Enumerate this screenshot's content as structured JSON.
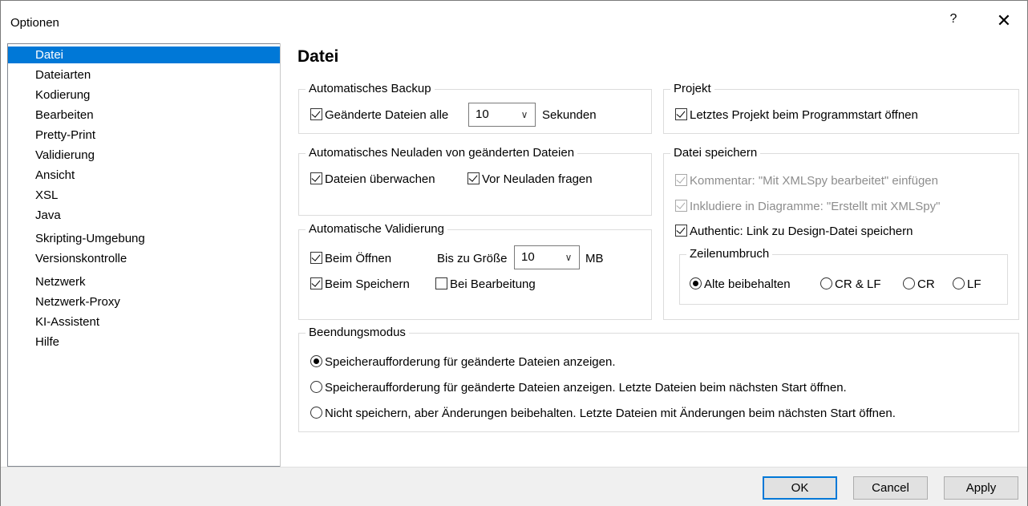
{
  "window": {
    "title": "Optionen",
    "help_label": "?",
    "close_label": "✕"
  },
  "sidebar": {
    "items": [
      {
        "label": "Datei",
        "selected": true
      },
      {
        "label": "Dateiarten"
      },
      {
        "label": "Kodierung"
      },
      {
        "label": "Bearbeiten"
      },
      {
        "label": "Pretty-Print"
      },
      {
        "label": "Validierung"
      },
      {
        "label": "Ansicht"
      },
      {
        "label": "XSL"
      },
      {
        "label": "Java"
      },
      {
        "label": "Skripting-Umgebung"
      },
      {
        "label": "Versionskontrolle"
      },
      {
        "label": "Netzwerk"
      },
      {
        "label": "Netzwerk-Proxy"
      },
      {
        "label": "KI-Assistent"
      },
      {
        "label": "Hilfe"
      }
    ]
  },
  "page": {
    "title": "Datei"
  },
  "backup": {
    "group_label": "Automatisches Backup",
    "checkbox_label": "Geänderte Dateien alle",
    "interval_value": "10",
    "unit_label": "Sekunden"
  },
  "reload": {
    "group_label": "Automatisches Neuladen von geänderten Dateien",
    "watch_label": "Dateien überwachen",
    "ask_label": "Vor Neuladen fragen"
  },
  "validation": {
    "group_label": "Automatische Validierung",
    "open_label": "Beim Öffnen",
    "size_label": "Bis zu Größe",
    "size_value": "10",
    "size_unit": "MB",
    "save_label": "Beim Speichern",
    "edit_label": "Bei Bearbeitung"
  },
  "project": {
    "group_label": "Projekt",
    "open_last_label": "Letztes Projekt beim Programmstart öffnen"
  },
  "save": {
    "group_label": "Datei speichern",
    "comment_label": "Kommentar: \"Mit XMLSpy bearbeitet\" einfügen",
    "include_label": "Inkludiere in Diagramme: \"Erstellt mit XMLSpy\"",
    "authentic_label": "Authentic: Link zu Design-Datei speichern",
    "linebreak": {
      "group_label": "Zeilenumbruch",
      "keep_label": "Alte beibehalten",
      "crlf_label": "CR & LF",
      "cr_label": "CR",
      "lf_label": "LF"
    }
  },
  "exit": {
    "group_label": "Beendungsmodus",
    "opt1": "Speicheraufforderung für geänderte Dateien anzeigen.",
    "opt2": "Speicheraufforderung für geänderte Dateien anzeigen. Letzte Dateien beim nächsten Start öffnen.",
    "opt3": "Nicht speichern, aber Änderungen beibehalten. Letzte Dateien mit Änderungen beim nächsten Start öffnen."
  },
  "buttons": {
    "ok": "OK",
    "cancel": "Cancel",
    "apply": "Apply"
  }
}
